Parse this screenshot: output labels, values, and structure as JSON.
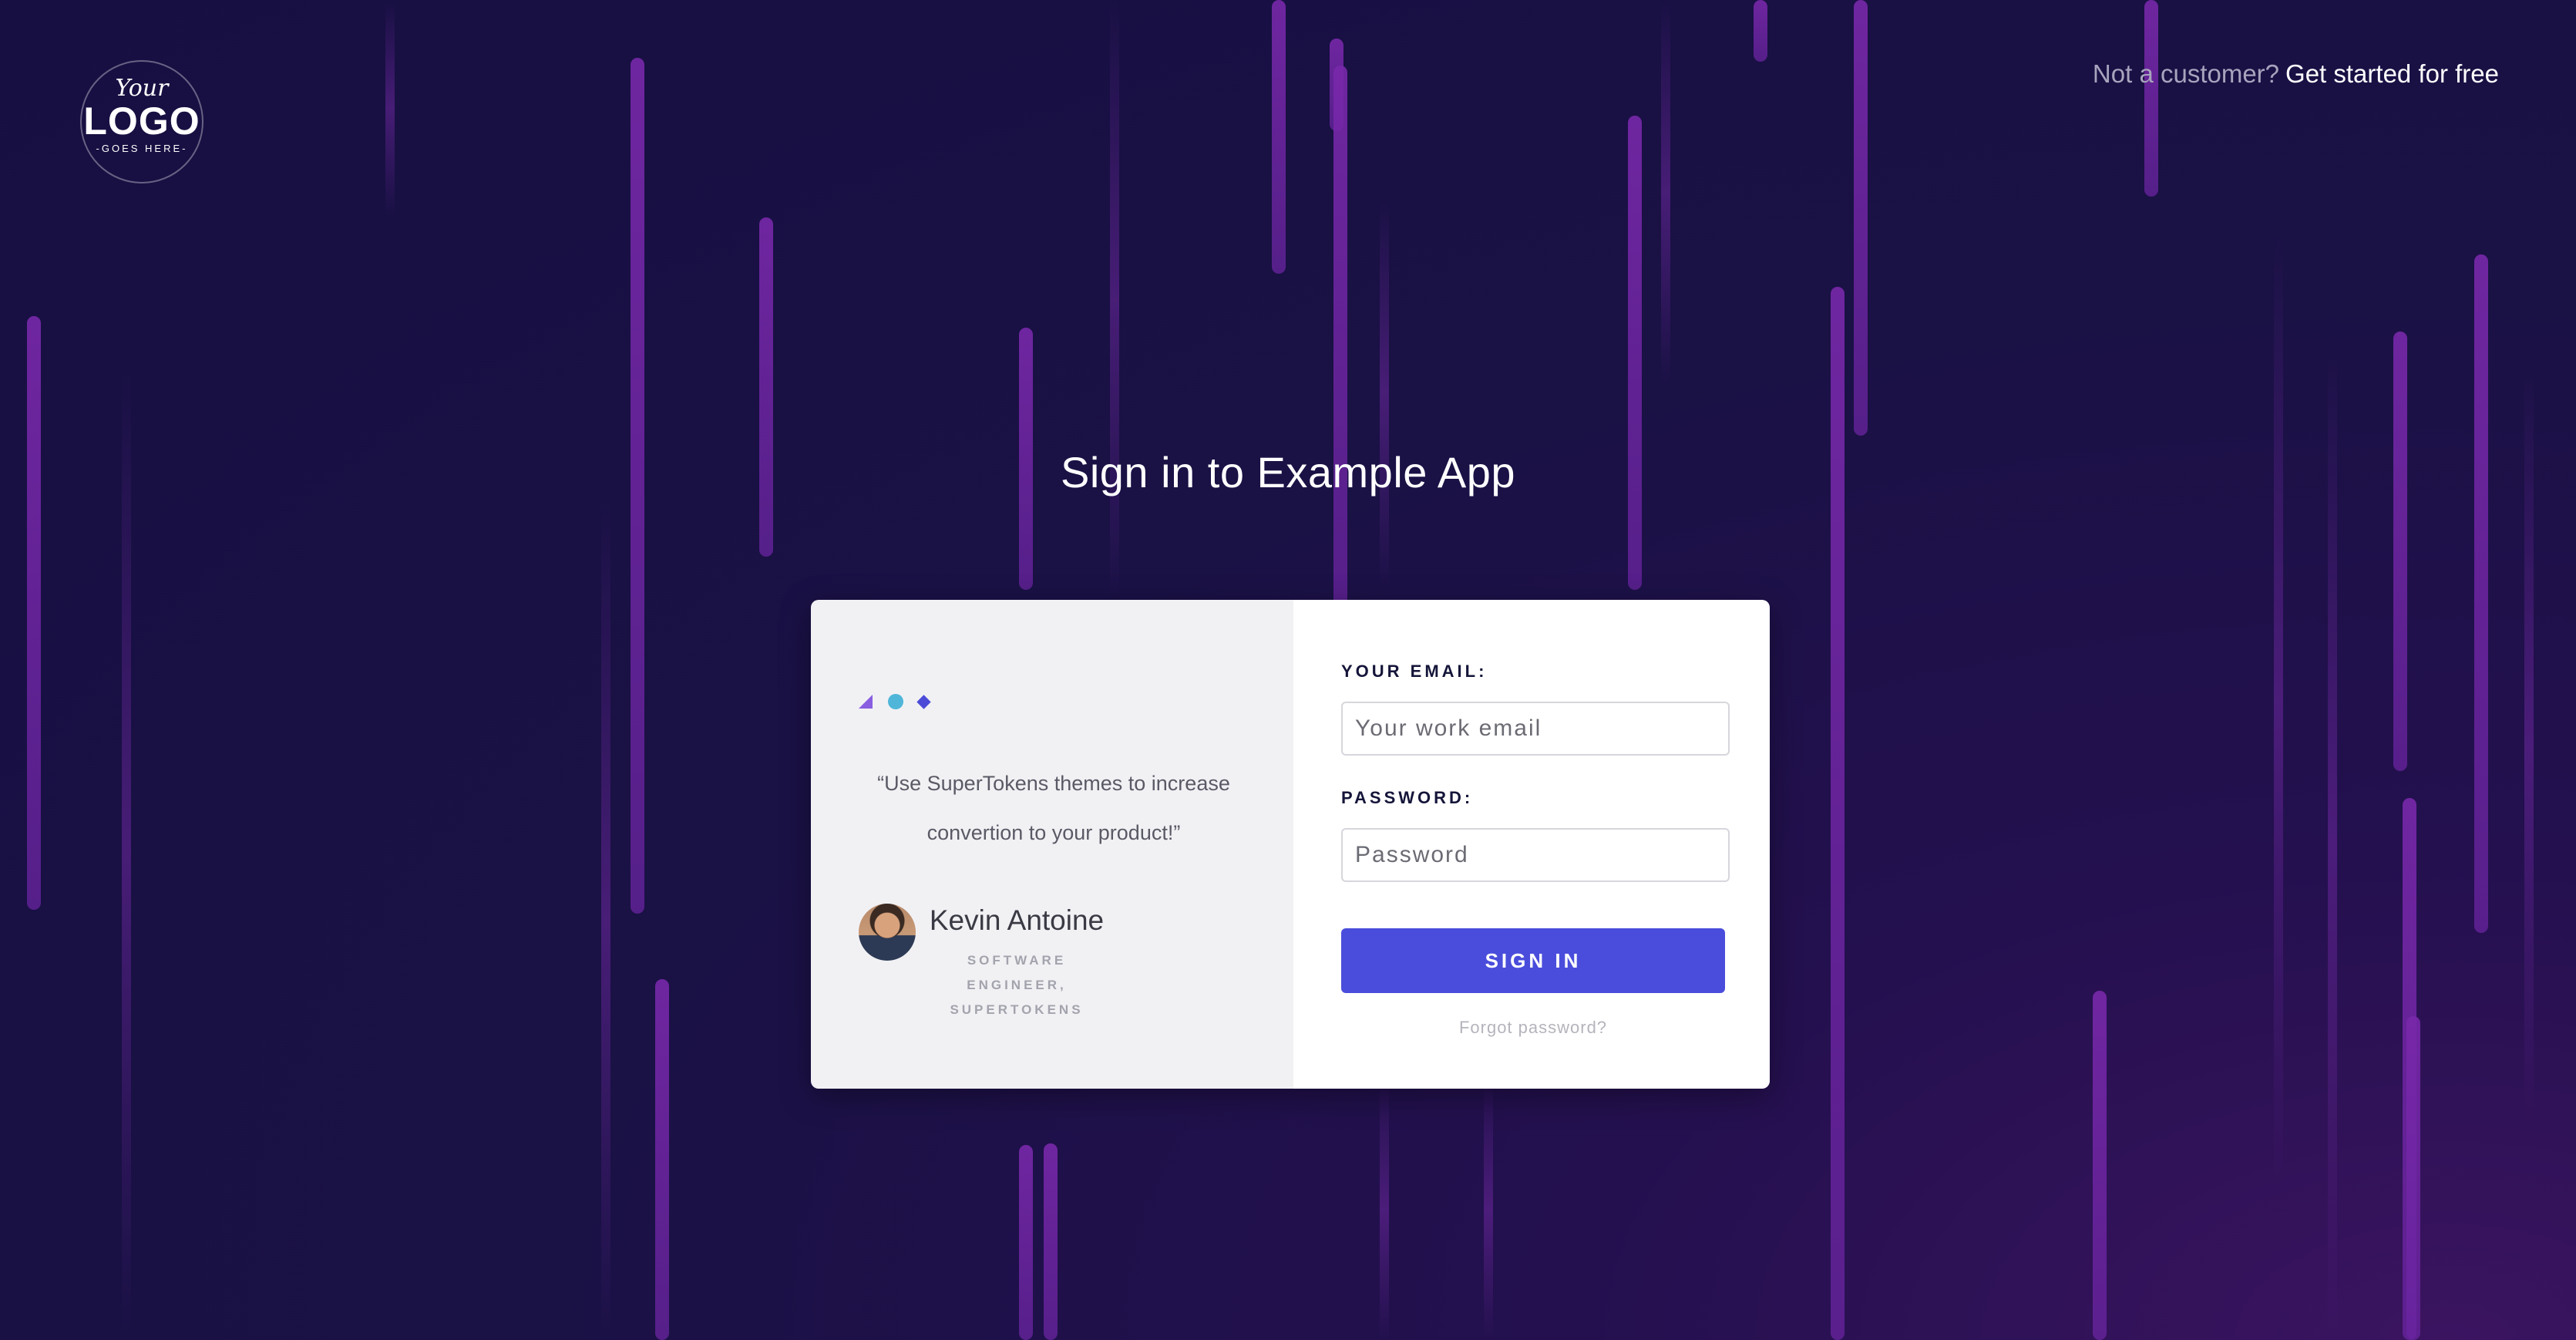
{
  "logo": {
    "line1": "Your",
    "line2": "LOGO",
    "line3": "-GOES HERE-"
  },
  "header": {
    "prompt": "Not a customer?",
    "cta_link": "Get started for free"
  },
  "page": {
    "title": "Sign in to Example App"
  },
  "testimonial": {
    "quote_line1": "“Use SuperTokens themes to increase",
    "quote_line2": "convertion to your product!”",
    "author_name": "Kevin Antoine",
    "author_role_line1": "SOFTWARE ENGINEER,",
    "author_role_line2": "SUPERTOKENS"
  },
  "form": {
    "email_label": "YOUR EMAIL:",
    "email_placeholder": "Your work email",
    "password_label": "PASSWORD:",
    "password_placeholder": "Password",
    "submit_label": "SIGN IN",
    "forgot_link": "Forgot password?"
  },
  "colors": {
    "background": "#170f42",
    "streak": "#7a28aa",
    "primary_button": "#4a4ddb",
    "card_left": "#f1f1f4",
    "card_right": "#ffffff"
  }
}
